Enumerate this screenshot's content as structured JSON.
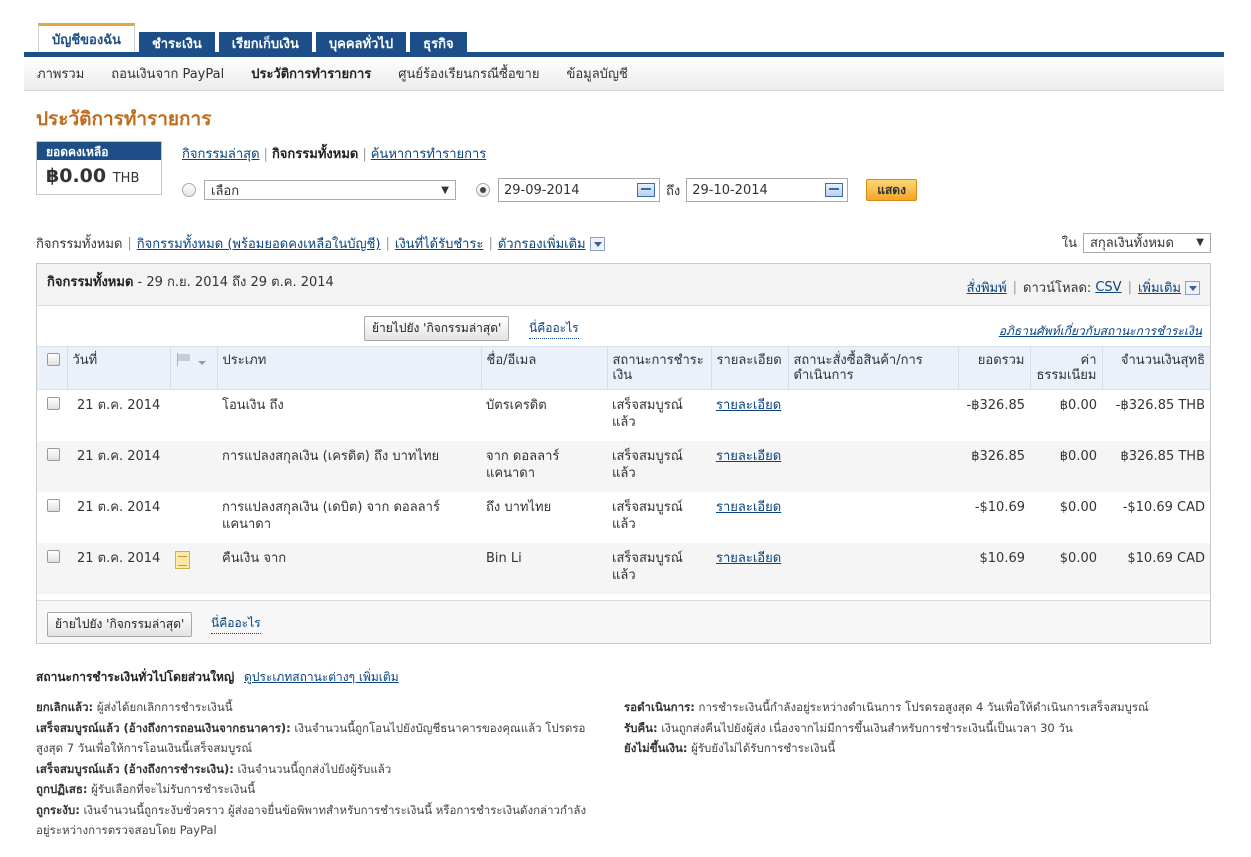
{
  "tabs": [
    "บัญชีของฉัน",
    "ชำระเงิน",
    "เรียกเก็บเงิน",
    "บุคคลทั่วไป",
    "ธุรกิจ"
  ],
  "subnav": [
    "ภาพรวม",
    "ถอนเงินจาก PayPal",
    "ประวัติการทำรายการ",
    "ศูนย์ร้องเรียนกรณีซื้อขาย",
    "ข้อมูลบัญชี"
  ],
  "page_title": "ประวัติการทำรายการ",
  "balance": {
    "label": "ยอดคงเหลือ",
    "amount": "฿0.00",
    "currency": "THB"
  },
  "view_links": {
    "recent": "กิจกรรมล่าสุด",
    "all": "กิจกรรมทั้งหมด",
    "search": "ค้นหาการทำรายการ"
  },
  "filter": {
    "select_value": "เลือก",
    "from_date": "29-09-2014",
    "to_label": "ถึง",
    "to_date": "29-10-2014",
    "show_button": "แสดง"
  },
  "activity_links": {
    "all": "กิจกรรมทั้งหมด",
    "all_with_balance": "กิจกรรมทั้งหมด (พร้อมยอดคงเหลือในบัญชี)",
    "received": "เงินที่ได้รับชำระ",
    "more_filters": "ตัวกรองเพิ่มเติม"
  },
  "currency_filter": {
    "label": "ใน",
    "value": "สกุลเงินทั้งหมด"
  },
  "panel": {
    "title_bold": "กิจกรรมทั้งหมด",
    "title_range": "- 29 ก.ย. 2014 ถึง 29 ต.ค. 2014",
    "print": "สั่งพิมพ์",
    "download_label": "ดาวน์โหลด:",
    "csv": "CSV",
    "more": "เพิ่มเติม",
    "move_button": "ย้ายไปยัง 'กิจกรรมล่าสุด'",
    "what_is_this": "นี่คืออะไร",
    "glossary": "อภิธานศัพท์เกี่ยวกับสถานะการชำระเงิน"
  },
  "columns": [
    "วันที่",
    "ประเภท",
    "ชื่อ/อีเมล",
    "สถานะการชำระเงิน",
    "รายละเอียด",
    "สถานะสั่งซื้อสินค้า/การดำเนินการ",
    "ยอดรวม",
    "ค่าธรรมเนียม",
    "จำนวนเงินสุทธิ"
  ],
  "rows": [
    {
      "date": "21 ต.ค. 2014",
      "type": "โอนเงิน ถึง",
      "name": "บัตรเครดิต",
      "status": "เสร็จสมบูรณ์แล้ว",
      "details": "รายละเอียด",
      "order_status": "",
      "gross": "-฿326.85",
      "fee": "฿0.00",
      "net": "-฿326.85 THB",
      "note": false
    },
    {
      "date": "21 ต.ค. 2014",
      "type": "การแปลงสกุลเงิน (เครดิต) ถึง บาทไทย",
      "name": "จาก ดอลลาร์แคนาดา",
      "status": "เสร็จสมบูรณ์แล้ว",
      "details": "รายละเอียด",
      "order_status": "",
      "gross": "฿326.85",
      "fee": "฿0.00",
      "net": "฿326.85 THB",
      "note": false
    },
    {
      "date": "21 ต.ค. 2014",
      "type": "การแปลงสกุลเงิน (เดบิต) จาก ดอลลาร์แคนาดา",
      "name": "ถึง บาทไทย",
      "status": "เสร็จสมบูรณ์แล้ว",
      "details": "รายละเอียด",
      "order_status": "",
      "gross": "-$10.69",
      "fee": "$0.00",
      "net": "-$10.69 CAD",
      "note": false
    },
    {
      "date": "21 ต.ค. 2014",
      "type": "คืนเงิน จาก",
      "name": "Bin Li",
      "status": "เสร็จสมบูรณ์แล้ว",
      "details": "รายละเอียด",
      "order_status": "",
      "gross": "$10.69",
      "fee": "$0.00",
      "net": "$10.69 CAD",
      "note": true
    }
  ],
  "legend": {
    "title": "สถานะการชำระเงินทั่วไปโดยส่วนใหญ่",
    "more_link": "ดูประเภทสถานะต่างๆ เพิ่มเติม",
    "left": [
      {
        "term": "ยกเลิกแล้ว:",
        "desc": "ผู้ส่งได้ยกเลิกการชำระเงินนี้"
      },
      {
        "term": "เสร็จสมบูรณ์แล้ว (อ้างถึงการถอนเงินจากธนาคาร):",
        "desc": "เงินจำนวนนี้ถูกโอนไปยังบัญชีธนาคารของคุณแล้ว โปรดรอสูงสุด 7 วันเพื่อให้การโอนเงินนี้เสร็จสมบูรณ์"
      },
      {
        "term": "เสร็จสมบูรณ์แล้ว (อ้างถึงการชำระเงิน):",
        "desc": "เงินจำนวนนี้ถูกส่งไปยังผู้รับแล้ว"
      },
      {
        "term": "ถูกปฏิเสธ:",
        "desc": "ผู้รับเลือกที่จะไม่รับการชำระเงินนี้"
      },
      {
        "term": "ถูกระงับ:",
        "desc": "เงินจำนวนนี้ถูกระงับชั่วคราว ผู้ส่งอาจยื่นข้อพิพาทสำหรับการชำระเงินนี้ หรือการชำระเงินดังกล่าวกำลังอยู่ระหว่างการตรวจสอบโดย PayPal"
      }
    ],
    "right": [
      {
        "term": "รอดำเนินการ:",
        "desc": "การชำระเงินนี้กำลังอยู่ระหว่างดำเนินการ โปรดรอสูงสุด 4 วันเพื่อให้ดำเนินการเสร็จสมบูรณ์"
      },
      {
        "term": "รับคืน:",
        "desc": "เงินถูกส่งคืนไปยังผู้ส่ง เนื่องจากไม่มีการขึ้นเงินสำหรับการชำระเงินนี้เป็นเวลา 30 วัน"
      },
      {
        "term": "ยังไม่ขึ้นเงิน:",
        "desc": "ผู้รับยังไม่ได้รับการชำระเงินนี้"
      }
    ]
  }
}
